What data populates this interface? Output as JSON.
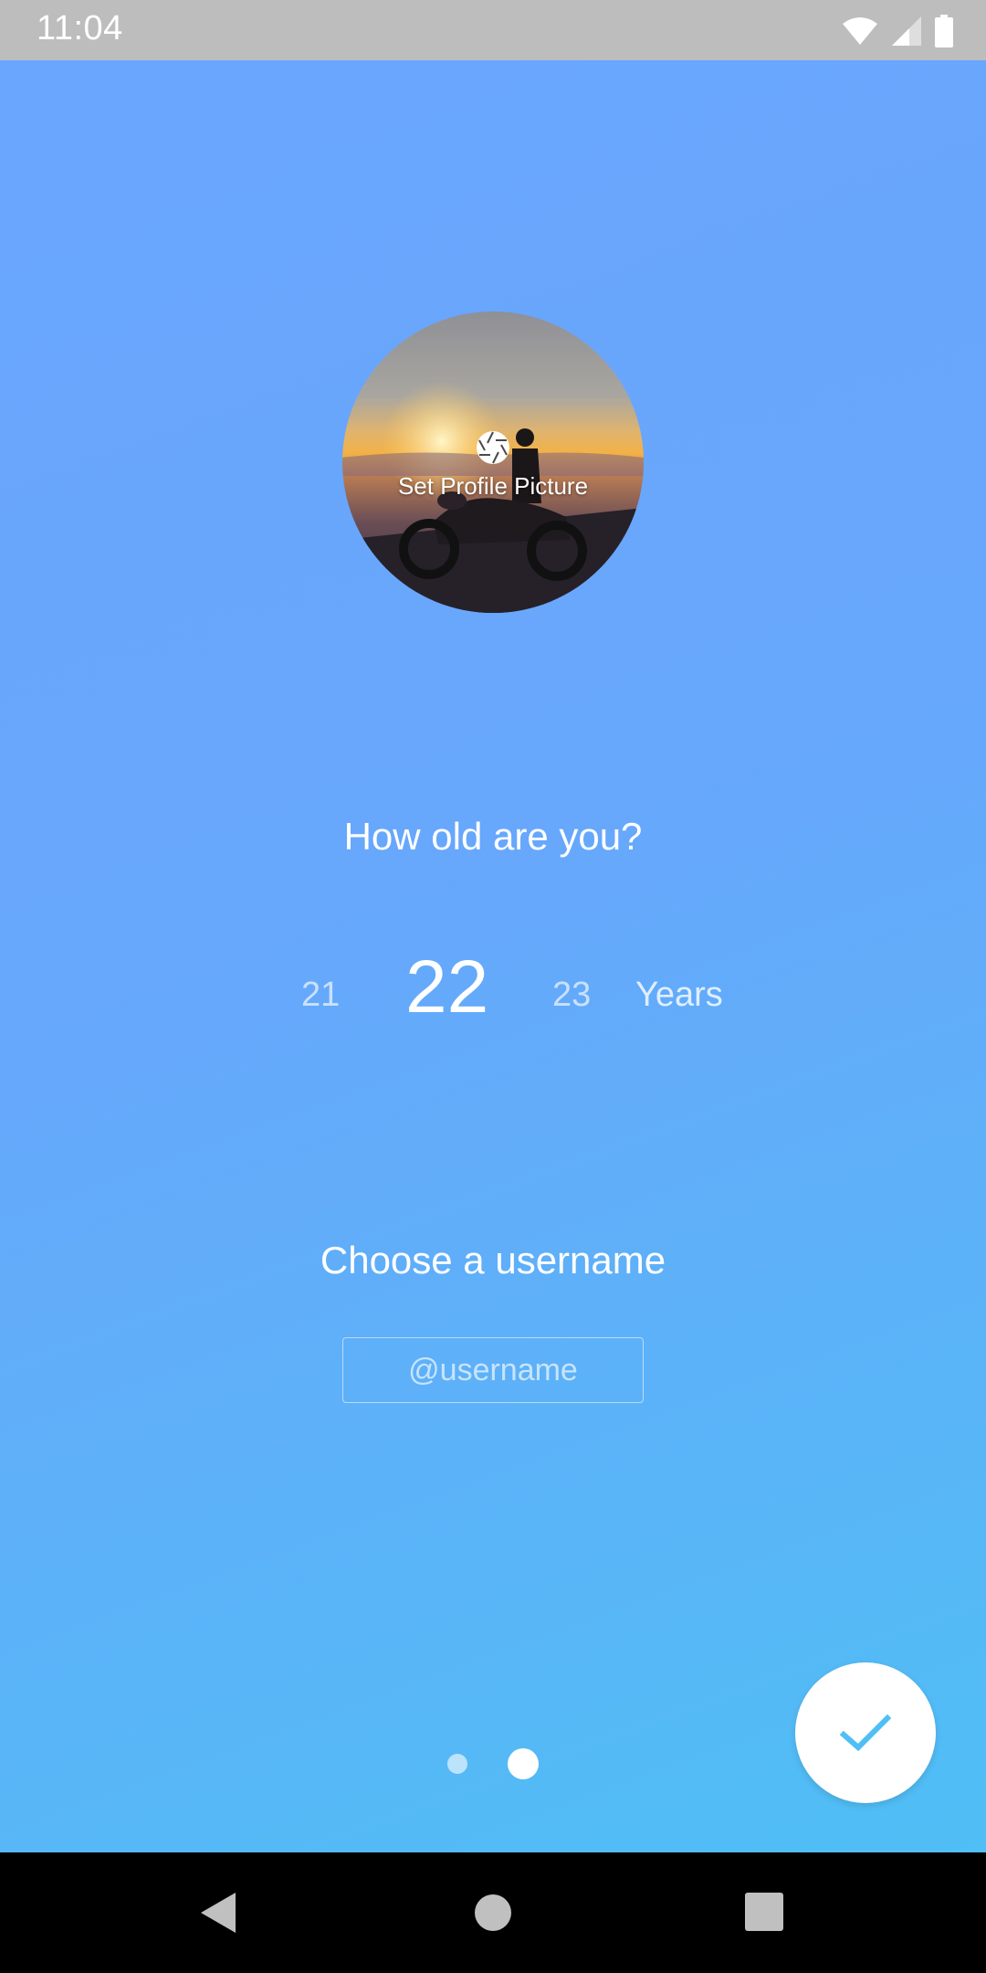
{
  "status_bar": {
    "time": "11:04",
    "icons": [
      "wifi-icon",
      "cellular-signal-icon",
      "battery-icon"
    ]
  },
  "profile": {
    "set_picture_label": "Set Profile Picture",
    "icon": "camera-shutter-icon"
  },
  "age": {
    "question": "How old are you?",
    "prev": "21",
    "selected": "22",
    "next": "23",
    "unit": "Years"
  },
  "username": {
    "title": "Choose a username",
    "placeholder": "@username",
    "value": ""
  },
  "pager": {
    "pages": 2,
    "current": 2
  },
  "fab": {
    "icon": "checkmark-icon"
  },
  "nav": {
    "icons": [
      "back-icon",
      "home-icon",
      "recents-icon"
    ]
  },
  "colors": {
    "gradient_start": "#6aa6fd",
    "gradient_end": "#4fbff5",
    "accent": "#4fbff5",
    "status_bar": "#bdbdbd"
  }
}
